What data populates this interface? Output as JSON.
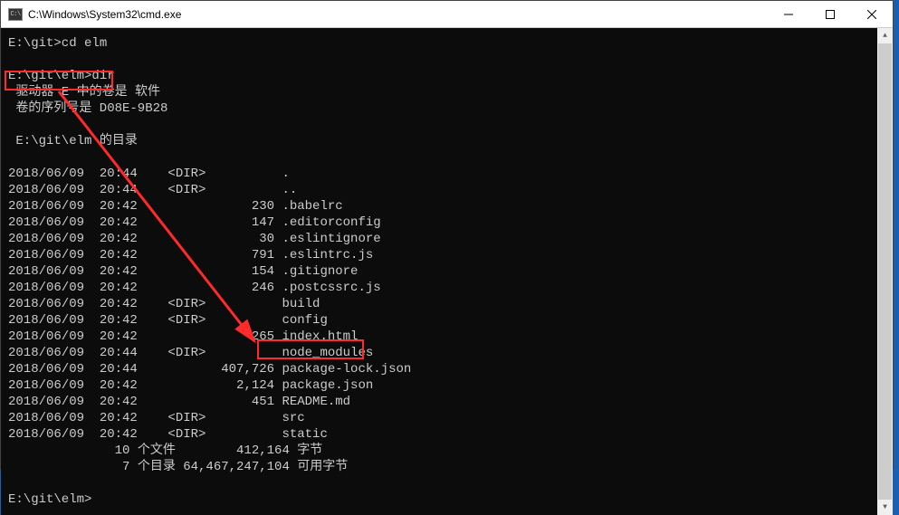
{
  "window": {
    "icon_label": "C:\\",
    "title": "C:\\Windows\\System32\\cmd.exe"
  },
  "terminal": {
    "line01": "E:\\git>cd elm",
    "line02": "",
    "line03": "E:\\git\\elm>dir",
    "line04": " 驱动器 E 中的卷是 软件",
    "line05": " 卷的序列号是 D08E-9B28",
    "line06": "",
    "line07": " E:\\git\\elm 的目录",
    "line08": "",
    "line09": "2018/06/09  20:44    <DIR>          .",
    "line10": "2018/06/09  20:44    <DIR>          ..",
    "line11": "2018/06/09  20:42               230 .babelrc",
    "line12": "2018/06/09  20:42               147 .editorconfig",
    "line13": "2018/06/09  20:42                30 .eslintignore",
    "line14": "2018/06/09  20:42               791 .eslintrc.js",
    "line15": "2018/06/09  20:42               154 .gitignore",
    "line16": "2018/06/09  20:42               246 .postcssrc.js",
    "line17": "2018/06/09  20:42    <DIR>          build",
    "line18": "2018/06/09  20:42    <DIR>          config",
    "line19": "2018/06/09  20:42               265 index.html",
    "line20": "2018/06/09  20:44    <DIR>          node_modules",
    "line21": "2018/06/09  20:44           407,726 package-lock.json",
    "line22": "2018/06/09  20:42             2,124 package.json",
    "line23": "2018/06/09  20:42               451 README.md",
    "line24": "2018/06/09  20:42    <DIR>          src",
    "line25": "2018/06/09  20:42    <DIR>          static",
    "line26": "              10 个文件        412,164 字节",
    "line27": "               7 个目录 64,467,247,104 可用字节",
    "line28": "",
    "line29": "E:\\git\\elm>"
  },
  "dir_listing": [
    {
      "date": "2018/06/09",
      "time": "20:44",
      "type": "<DIR>",
      "size": "",
      "name": "."
    },
    {
      "date": "2018/06/09",
      "time": "20:44",
      "type": "<DIR>",
      "size": "",
      "name": ".."
    },
    {
      "date": "2018/06/09",
      "time": "20:42",
      "type": "",
      "size": "230",
      "name": ".babelrc"
    },
    {
      "date": "2018/06/09",
      "time": "20:42",
      "type": "",
      "size": "147",
      "name": ".editorconfig"
    },
    {
      "date": "2018/06/09",
      "time": "20:42",
      "type": "",
      "size": "30",
      "name": ".eslintignore"
    },
    {
      "date": "2018/06/09",
      "time": "20:42",
      "type": "",
      "size": "791",
      "name": ".eslintrc.js"
    },
    {
      "date": "2018/06/09",
      "time": "20:42",
      "type": "",
      "size": "154",
      "name": ".gitignore"
    },
    {
      "date": "2018/06/09",
      "time": "20:42",
      "type": "",
      "size": "246",
      "name": ".postcssrc.js"
    },
    {
      "date": "2018/06/09",
      "time": "20:42",
      "type": "<DIR>",
      "size": "",
      "name": "build"
    },
    {
      "date": "2018/06/09",
      "time": "20:42",
      "type": "<DIR>",
      "size": "",
      "name": "config"
    },
    {
      "date": "2018/06/09",
      "time": "20:42",
      "type": "",
      "size": "265",
      "name": "index.html"
    },
    {
      "date": "2018/06/09",
      "time": "20:44",
      "type": "<DIR>",
      "size": "",
      "name": "node_modules"
    },
    {
      "date": "2018/06/09",
      "time": "20:44",
      "type": "",
      "size": "407,726",
      "name": "package-lock.json"
    },
    {
      "date": "2018/06/09",
      "time": "20:42",
      "type": "",
      "size": "2,124",
      "name": "package.json"
    },
    {
      "date": "2018/06/09",
      "time": "20:42",
      "type": "",
      "size": "451",
      "name": "README.md"
    },
    {
      "date": "2018/06/09",
      "time": "20:42",
      "type": "<DIR>",
      "size": "",
      "name": "src"
    },
    {
      "date": "2018/06/09",
      "time": "20:42",
      "type": "<DIR>",
      "size": "",
      "name": "static"
    }
  ],
  "summary": {
    "files_count": "10",
    "files_bytes": "412,164",
    "dirs_count": "7",
    "free_bytes": "64,467,247,104"
  },
  "annotations": {
    "highlight1_target": "E:\\git\\elm>dir",
    "highlight2_target": "node_modules",
    "arrow_color": "#ff2a2a"
  }
}
